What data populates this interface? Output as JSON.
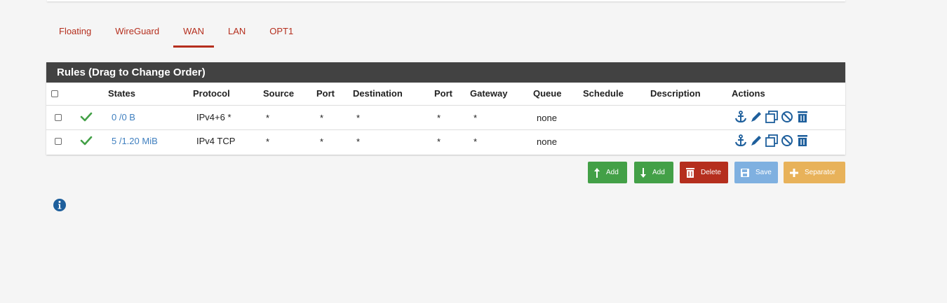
{
  "tabs": [
    "Floating",
    "WireGuard",
    "WAN",
    "LAN",
    "OPT1"
  ],
  "active_tab": "WAN",
  "panel": {
    "title": "Rules (Drag to Change Order)"
  },
  "columns": {
    "states": "States",
    "protocol": "Protocol",
    "source": "Source",
    "port": "Port",
    "destination": "Destination",
    "port2": "Port",
    "gateway": "Gateway",
    "queue": "Queue",
    "schedule": "Schedule",
    "description": "Description",
    "actions": "Actions"
  },
  "rows": [
    {
      "states": "0 /0 B",
      "protocol": "IPv4+6 *",
      "source": "*",
      "port": "*",
      "destination": "*",
      "port2": "*",
      "gateway": "*",
      "queue": "none",
      "schedule": "",
      "description": ""
    },
    {
      "states": "5 /1.20 MiB",
      "protocol": "IPv4 TCP",
      "source": "*",
      "port": "*",
      "destination": "*",
      "port2": "*",
      "gateway": "*",
      "queue": "none",
      "schedule": "",
      "description": ""
    }
  ],
  "action_icons": [
    "anchor-icon",
    "pencil-icon",
    "copy-icon",
    "ban-icon",
    "trash-icon"
  ],
  "buttons": {
    "add_top": "Add",
    "add_bottom": "Add",
    "delete": "Delete",
    "save": "Save",
    "separator": "Separator"
  },
  "colors": {
    "tab": "#b52f1e",
    "heading": "#424242",
    "link": "#3f7fbf",
    "pass": "#43a047",
    "add": "#43a047",
    "delete": "#b52f1e",
    "save": "#7fb0e0",
    "separator": "#e8b25a"
  }
}
